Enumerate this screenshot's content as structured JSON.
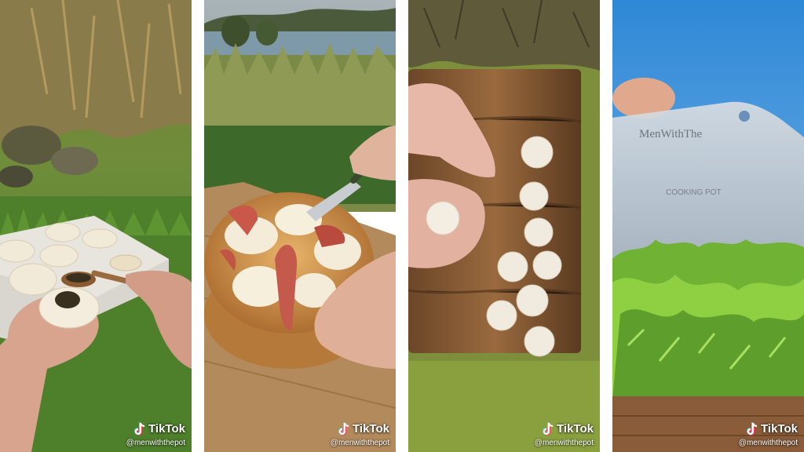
{
  "watermark": {
    "brand": "TikTok",
    "handle": "@menwiththepot"
  },
  "board_engraving": {
    "brand": "MenWithThe",
    "line2": "COOKING POT"
  },
  "icons": {
    "watermark_logo": "tiktok-logo-icon"
  }
}
